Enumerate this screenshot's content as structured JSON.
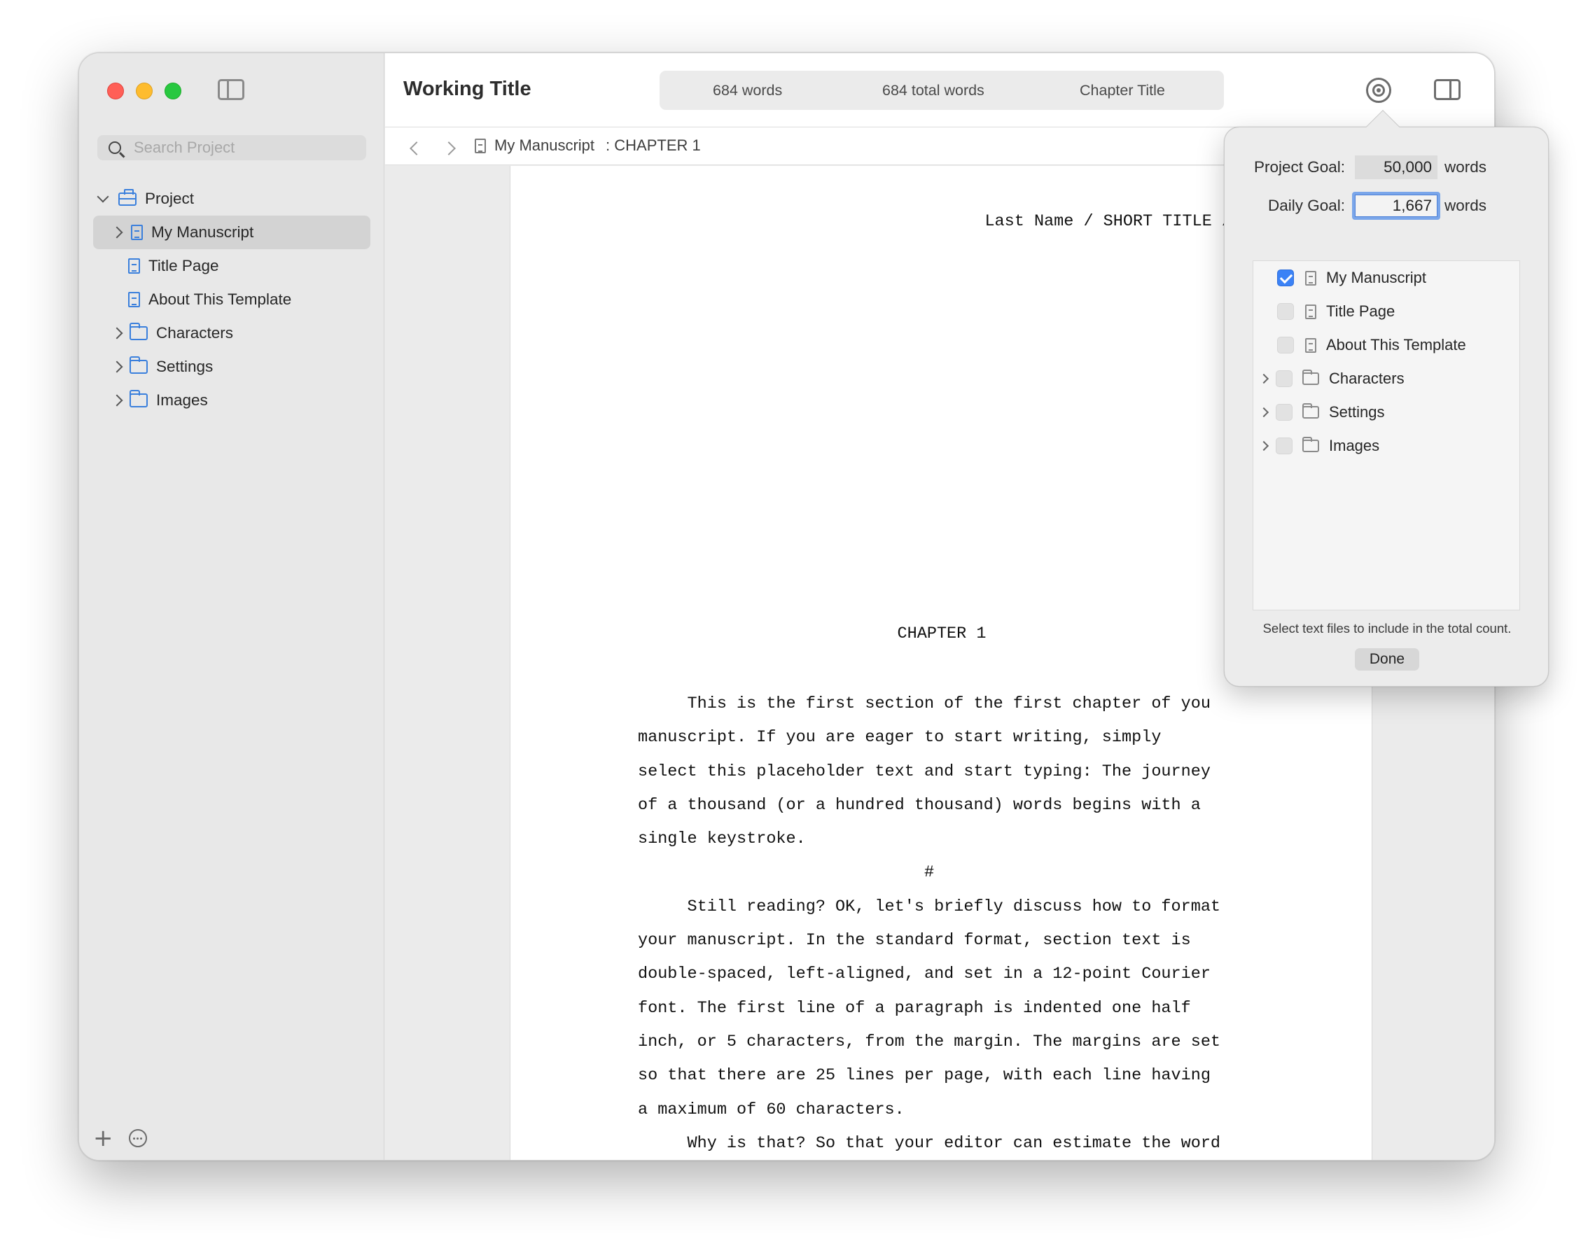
{
  "window": {
    "title": "Working Title"
  },
  "sidebar": {
    "search_placeholder": "Search Project",
    "root_label": "Project",
    "items": [
      {
        "label": "My Manuscript",
        "kind": "doc",
        "expandable": true,
        "selected": true
      },
      {
        "label": "Title Page",
        "kind": "doc",
        "expandable": false
      },
      {
        "label": "About This Template",
        "kind": "doc",
        "expandable": false
      },
      {
        "label": "Characters",
        "kind": "folder",
        "expandable": true
      },
      {
        "label": "Settings",
        "kind": "folder",
        "expandable": true
      },
      {
        "label": "Images",
        "kind": "folder",
        "expandable": true
      }
    ],
    "add_icon": "+"
  },
  "toolbar": {
    "words": "684 words",
    "total_words": "684 total words",
    "chapter": "Chapter Title"
  },
  "breadcrumb": {
    "item": "My Manuscript",
    "section": ": CHAPTER 1"
  },
  "editor": {
    "header": "Last Name / SHORT TITLE /",
    "chapter_heading": "CHAPTER 1",
    "body": "     This is the first section of the first chapter of you\nmanuscript. If you are eager to start writing, simply\nselect this placeholder text and start typing: The journey\nof a thousand (or a hundred thousand) words begins with a\nsingle keystroke.\n                             #\n     Still reading? OK, let's briefly discuss how to format\nyour manuscript. In the standard format, section text is\ndouble-spaced, left-aligned, and set in a 12-point Courier\nfont. The first line of a paragraph is indented one half\ninch, or 5 characters, from the margin. The margins are set\nso that there are 25 lines per page, with each line having\na maximum of 60 characters.\n     Why is that? So that your editor can estimate the word\ncount and accurately determine the final page count of your"
  },
  "goals_popover": {
    "project_goal_label": "Project Goal:",
    "project_goal_value": "50,000",
    "daily_goal_label": "Daily Goal:",
    "daily_goal_value": "1,667",
    "unit": "words",
    "files": [
      {
        "label": "My Manuscript",
        "kind": "doc",
        "checked": true,
        "expandable": false
      },
      {
        "label": "Title Page",
        "kind": "doc",
        "checked": false,
        "expandable": false
      },
      {
        "label": "About This Template",
        "kind": "doc",
        "checked": false,
        "expandable": false
      },
      {
        "label": "Characters",
        "kind": "folder",
        "checked": false,
        "expandable": true
      },
      {
        "label": "Settings",
        "kind": "folder",
        "checked": false,
        "expandable": true
      },
      {
        "label": "Images",
        "kind": "folder",
        "checked": false,
        "expandable": true
      }
    ],
    "hint": "Select text files to include in the total count.",
    "done_label": "Done"
  },
  "colors": {
    "accent": "#3a7fdc",
    "close": "#ff5f57",
    "minimize": "#febc2e",
    "maximize": "#28c840"
  }
}
